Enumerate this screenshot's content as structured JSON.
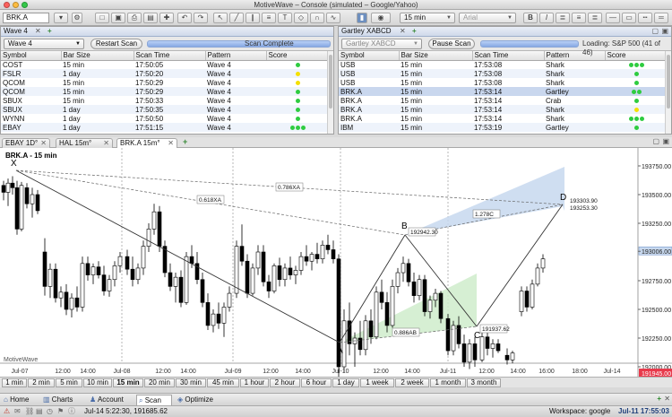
{
  "window": {
    "title": "MotiveWave – Console (simulated – Google/Yahoo)"
  },
  "toolbar": {
    "symbol": "BRK.A",
    "bar_size": "15 min",
    "font": "Arial"
  },
  "wave_panel": {
    "tab_title": "Wave 4",
    "selector": "Wave 4",
    "restart_label": "Restart Scan",
    "status": "Scan Complete",
    "columns": [
      "Symbol",
      "Bar Size",
      "Scan Time",
      "Pattern",
      "Score"
    ],
    "rows": [
      {
        "symbol": "COST",
        "bar": "15 min",
        "time": "17:50:05",
        "pattern": "Wave 4",
        "score": 1,
        "color": "#2ecc40"
      },
      {
        "symbol": "FSLR",
        "bar": "1 day",
        "time": "17:50:20",
        "pattern": "Wave 4",
        "score": 1,
        "color": "#f5e000"
      },
      {
        "symbol": "QCOM",
        "bar": "15 min",
        "time": "17:50:29",
        "pattern": "Wave 4",
        "score": 1,
        "color": "#f5e000"
      },
      {
        "symbol": "QCOM",
        "bar": "15 min",
        "time": "17:50:29",
        "pattern": "Wave 4",
        "score": 1,
        "color": "#2ecc40"
      },
      {
        "symbol": "SBUX",
        "bar": "15 min",
        "time": "17:50:33",
        "pattern": "Wave 4",
        "score": 1,
        "color": "#2ecc40"
      },
      {
        "symbol": "SBUX",
        "bar": "1 day",
        "time": "17:50:35",
        "pattern": "Wave 4",
        "score": 1,
        "color": "#2ecc40"
      },
      {
        "symbol": "WYNN",
        "bar": "1 day",
        "time": "17:50:50",
        "pattern": "Wave 4",
        "score": 1,
        "color": "#2ecc40"
      },
      {
        "symbol": "EBAY",
        "bar": "1 day",
        "time": "17:51:15",
        "pattern": "Wave 4",
        "score": 3,
        "color": "#2ecc40"
      }
    ]
  },
  "gartley_panel": {
    "tab_title": "Gartley XABCD",
    "selector": "Gartley XABCD",
    "pause_label": "Pause Scan",
    "status": "Loading: S&P 500 (41 of 46)",
    "columns": [
      "Symbol",
      "Bar Size",
      "Scan Time",
      "Pattern",
      "Score"
    ],
    "rows": [
      {
        "symbol": "USB",
        "bar": "15 min",
        "time": "17:53:08",
        "pattern": "Shark",
        "score": 3,
        "color": "#2ecc40"
      },
      {
        "symbol": "USB",
        "bar": "15 min",
        "time": "17:53:08",
        "pattern": "Shark",
        "score": 1,
        "color": "#2ecc40"
      },
      {
        "symbol": "USB",
        "bar": "15 min",
        "time": "17:53:08",
        "pattern": "Shark",
        "score": 1,
        "color": "#2ecc40"
      },
      {
        "symbol": "BRK.A",
        "bar": "15 min",
        "time": "17:53:14",
        "pattern": "Gartley",
        "score": 2,
        "color": "#2ecc40"
      },
      {
        "symbol": "BRK.A",
        "bar": "15 min",
        "time": "17:53:14",
        "pattern": "Crab",
        "score": 1,
        "color": "#2ecc40"
      },
      {
        "symbol": "BRK.A",
        "bar": "15 min",
        "time": "17:53:14",
        "pattern": "Shark",
        "score": 1,
        "color": "#f5e000"
      },
      {
        "symbol": "BRK.A",
        "bar": "15 min",
        "time": "17:53:14",
        "pattern": "Shark",
        "score": 3,
        "color": "#2ecc40"
      },
      {
        "symbol": "IBM",
        "bar": "15 min",
        "time": "17:53:19",
        "pattern": "Gartley",
        "score": 1,
        "color": "#2ecc40"
      }
    ]
  },
  "chart_tabs": [
    "EBAY 1D°",
    "HAL 15m°",
    "BRK.A 15m°"
  ],
  "chart": {
    "title": "BRK.A - 15 min",
    "watermark": "MotiveWave",
    "x_labels": [
      "Jul-07",
      "12:00",
      "14:00",
      "Jul-08",
      "12:00",
      "14:00",
      "Jul-09",
      "12:00",
      "14:00",
      "Jul-10",
      "12:00",
      "14:00",
      "Jul-11",
      "12:00",
      "14:00",
      "16:00",
      "18:00",
      "Jul-14"
    ],
    "y_labels": [
      "193750.00",
      "193500.00",
      "193250.00",
      "193006.00",
      "192750.00",
      "192500.00",
      "192250.00",
      "192000.00"
    ],
    "last_price": "191945.00",
    "points": {
      "X": "X",
      "A": "A",
      "B": "B",
      "C": "C",
      "D": "D"
    },
    "ratios": {
      "xa_xd": "0.786XA",
      "xa_xb": "0.618XA",
      "bc_cd": "1.278C",
      "ab_bc": "0.886AB"
    },
    "b_price": "192942.30",
    "c_price": "191937.62",
    "d_price_1": "193303.90",
    "d_price_2": "193253.30"
  },
  "bar_sizes": [
    "1 min",
    "2 min",
    "5 min",
    "10 min",
    "15 min",
    "20 min",
    "30 min",
    "45 min",
    "1 hour",
    "2 hour",
    "6 hour",
    "1 day",
    "1 week",
    "2 week",
    "1 month",
    "3 month"
  ],
  "bar_sizes_active": "15 min",
  "nav": {
    "home": "Home",
    "charts": "Charts",
    "account": "Account",
    "scan": "Scan",
    "optimize": "Optimize"
  },
  "status": {
    "cursor": "Jul-14 5:22:30, 191685.62",
    "workspace": "Workspace: google",
    "clock": "Jul-11 17:55:03"
  },
  "colors": {
    "green_fill": "#cfeccb",
    "blue_fill": "#c7d8ee",
    "up_bar": "#ffffff",
    "down_bar": "#000000"
  }
}
